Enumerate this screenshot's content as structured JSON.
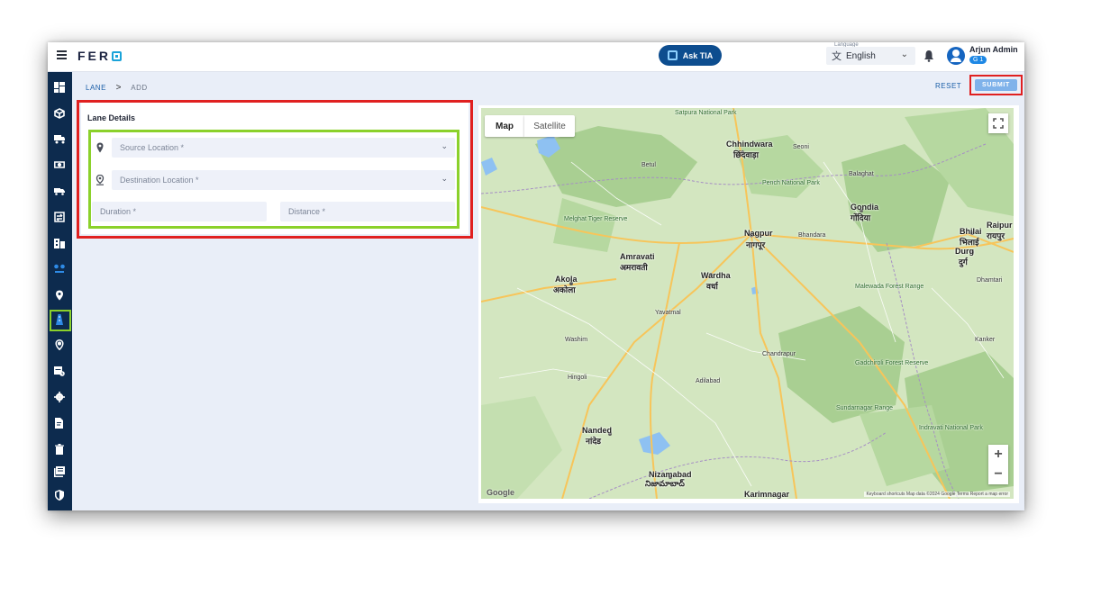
{
  "header": {
    "logo_text": "FER",
    "ask_tia_label": "Ask TIA",
    "language": {
      "label": "Language",
      "value": "English"
    },
    "user": {
      "name": "Arjun Admin",
      "badge": "G 1"
    }
  },
  "breadcrumb": {
    "parent": "LANE",
    "separator": ">",
    "current": "ADD"
  },
  "actions": {
    "reset_label": "RESET",
    "submit_label": "SUBMIT"
  },
  "lane_details": {
    "title": "Lane Details",
    "source_placeholder": "Source Location *",
    "destination_placeholder": "Destination Location *",
    "duration_placeholder": "Duration *",
    "distance_placeholder": "Distance *"
  },
  "map": {
    "tabs": {
      "map": "Map",
      "satellite": "Satellite"
    },
    "labels": {
      "chhindwara": "Chhindwara",
      "chhindwara_local": "छिंदवाड़ा",
      "nagpur": "Nagpur",
      "nagpur_local": "नागपूर",
      "amravati": "Amravati",
      "amravati_local": "अमरावती",
      "wardha": "Wardha",
      "wardha_local": "वर्धा",
      "akola": "Akola",
      "akola_local": "अकोला",
      "gondia": "Gondia",
      "gondia_local": "गोंदिया",
      "raipur": "Raipur",
      "raipur_local": "रायपुर",
      "bhilai": "Bhilai",
      "bhilai_local": "भिलाई",
      "durg": "Durg",
      "durg_local": "दुर्ग",
      "nanded": "Nanded",
      "nanded_local": "नांदेड",
      "nizamabad": "Nizamabad",
      "nizamabad_local": "నిజామాబాద్",
      "karimnagar": "Karimnagar",
      "pench": "Pench National Park",
      "melghat": "Melghat Tiger Reserve",
      "gadchiroli": "Gadchiroli Forest Reserve",
      "malewada": "Malewada Forest Range",
      "indravati": "Indravati National Park",
      "sundarnagar": "Sundarnagar Range",
      "satpura": "Satpura National Park",
      "betul": "Betul",
      "yavatmal": "Yavatmal",
      "chandrapur": "Chandrapur",
      "hingoli": "Hingoli",
      "washim": "Washim",
      "adilabad": "Adilabad",
      "bhandara": "Bhandara",
      "balaghat": "Balaghat",
      "seoni": "Seoni",
      "kanker": "Kanker",
      "dhamtari": "Dhamtari"
    },
    "zoom_in": "+",
    "zoom_out": "−",
    "google": "Google",
    "attribution": "Keyboard shortcuts   Map data ©2024 Google   Terms   Report a map error"
  }
}
